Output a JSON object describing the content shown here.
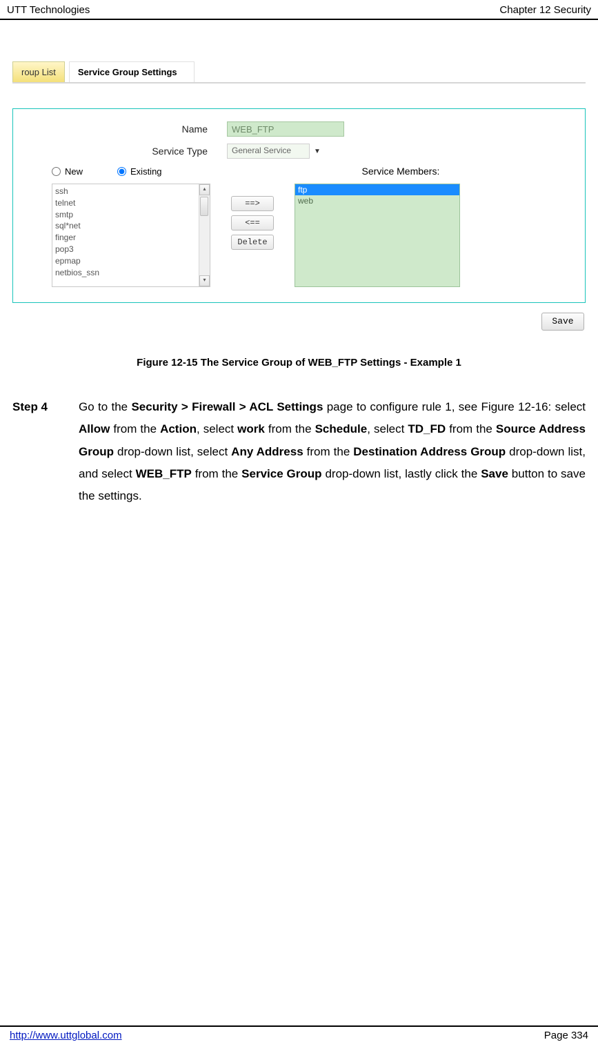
{
  "header": {
    "left": "UTT Technologies",
    "right": "Chapter 12 Security"
  },
  "tabs": {
    "inactive": "roup List",
    "active": "Service Group Settings"
  },
  "form": {
    "name_label": "Name",
    "name_value": "WEB_FTP",
    "service_type_label": "Service Type",
    "service_type_value": "General Service",
    "radio_new": "New",
    "radio_existing": "Existing",
    "members_label": "Service Members:",
    "available": [
      "ssh",
      "telnet",
      "smtp",
      "sql*net",
      "finger",
      "pop3",
      "epmap",
      "netbios_ssn"
    ],
    "buttons": {
      "add": "==>",
      "remove": "<==",
      "delete": "Delete"
    },
    "selected_members": [
      "ftp",
      "web"
    ],
    "save": "Save"
  },
  "caption": "Figure 12-15 The Service Group of WEB_FTP Settings - Example 1",
  "step": {
    "label": "Step 4",
    "t1": "Go to the ",
    "b1": "Security > Firewall > ACL Settings",
    "t2": " page to configure rule 1, see Figure 12-16: select ",
    "b2": "Allow",
    "t3": " from the ",
    "b3": "Action",
    "t4": ", select ",
    "b4": "work",
    "t5": " from the ",
    "b5": "Schedule",
    "t6": ", select ",
    "b6": "TD_FD",
    "t7": " from the ",
    "b7": "Source Address Group",
    "t8": " drop-down list, select ",
    "b8": "Any Address",
    "t9": " from the ",
    "b9": "Destination Address Group",
    "t10": " drop-down list, and select ",
    "b10": "WEB_FTP",
    "t11": " from the ",
    "b11": "Service Group",
    "t12": " drop-down list, lastly click the ",
    "b12": "Save",
    "t13": " button to save the settings."
  },
  "footer": {
    "url": "http://www.uttglobal.com",
    "page": "Page 334"
  }
}
